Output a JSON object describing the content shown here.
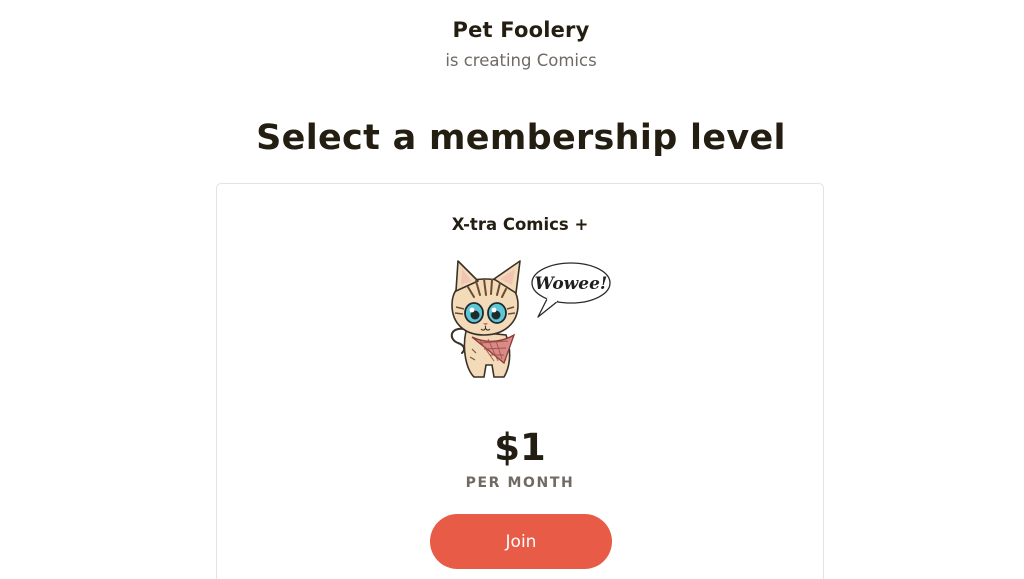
{
  "creator": {
    "name": "Pet Foolery",
    "subtitle": "is creating Comics"
  },
  "heading": "Select a membership level",
  "tier": {
    "title": "X-tra Comics +",
    "image": {
      "speech_bubble_text": "Wowee!"
    },
    "price": "$1",
    "period": "PER MONTH",
    "join_label": "Join",
    "accent_color": "#e85b46"
  }
}
